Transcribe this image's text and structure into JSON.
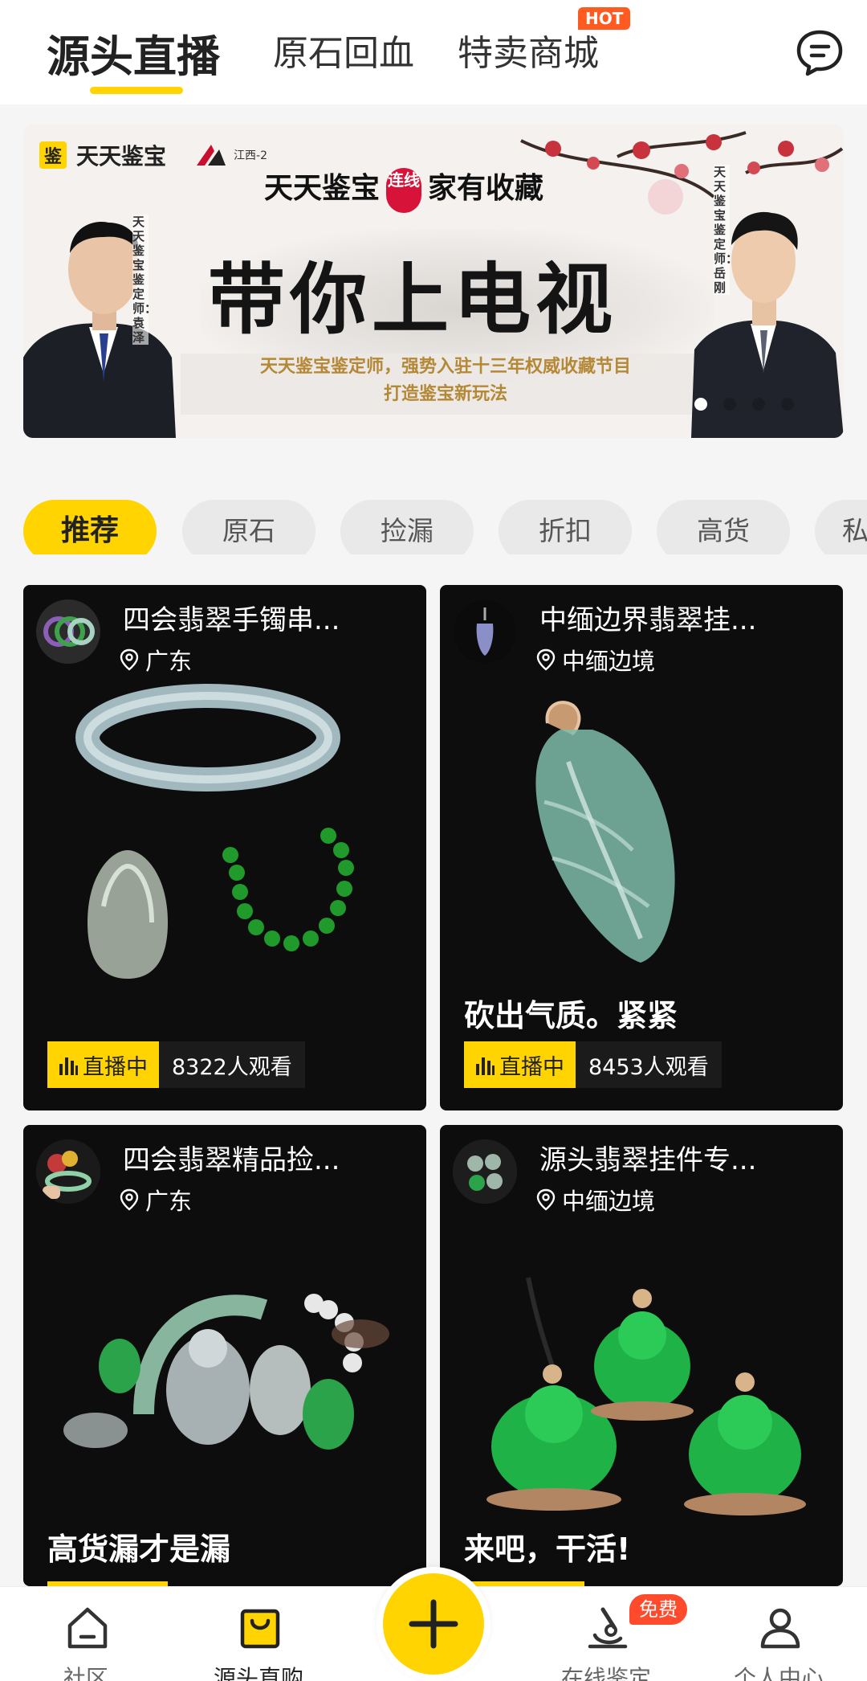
{
  "top_tabs": [
    {
      "label": "源头直播",
      "active": true
    },
    {
      "label": "原石回血",
      "active": false
    },
    {
      "label": "特卖商城",
      "active": false,
      "badge": "HOT"
    }
  ],
  "banner": {
    "brand_logo_char": "鉴",
    "brand_name": "天天鉴宝",
    "tv_name": "江西-2",
    "subtitle_left": "天天鉴宝",
    "subtitle_badge": "连线",
    "subtitle_right": "家有收藏",
    "title": "带你上电视",
    "desc_line1": "天天鉴宝鉴定师，强势入驻十三年权威收藏节目",
    "desc_line2": "打造鉴宝新玩法",
    "left_caption": "天天鉴宝鉴定师：袁泽",
    "right_caption": "天天鉴宝鉴定师：岳刚",
    "slide_count": 4,
    "active_slide": 1
  },
  "categories": [
    "推荐",
    "原石",
    "捡漏",
    "折扣",
    "高货",
    "私"
  ],
  "active_category": 0,
  "streams": [
    {
      "title": "四会翡翠手镯串...",
      "location": "广东",
      "caption": "",
      "live_label": "直播中",
      "viewers": "8322人观看"
    },
    {
      "title": "中缅边界翡翠挂...",
      "location": "中缅边境",
      "caption": "砍出气质。紧紧",
      "live_label": "直播中",
      "viewers": "8453人观看"
    },
    {
      "title": "四会翡翠精品捡...",
      "location": "广东",
      "caption": "高货漏才是漏",
      "live_label": "",
      "viewers": ""
    },
    {
      "title": "源头翡翠挂件专...",
      "location": "中缅边境",
      "caption": "来吧，干活!",
      "live_label": "",
      "viewers": ""
    }
  ],
  "bottom_nav": [
    {
      "label": "社区",
      "icon": "home-icon",
      "active": false
    },
    {
      "label": "源头直购",
      "icon": "shopping-bag-icon",
      "active": true
    },
    {
      "label": "",
      "icon": "plus-icon",
      "active": false
    },
    {
      "label": "在线鉴定",
      "icon": "microscope-icon",
      "active": false,
      "badge": "免费"
    },
    {
      "label": "个人中心",
      "icon": "person-icon",
      "active": false
    }
  ],
  "colors": {
    "accent": "#FFD400",
    "hot": "#FF5A1F",
    "card_bg": "#0d0d0d",
    "free_badge": "#FF4A2B"
  }
}
